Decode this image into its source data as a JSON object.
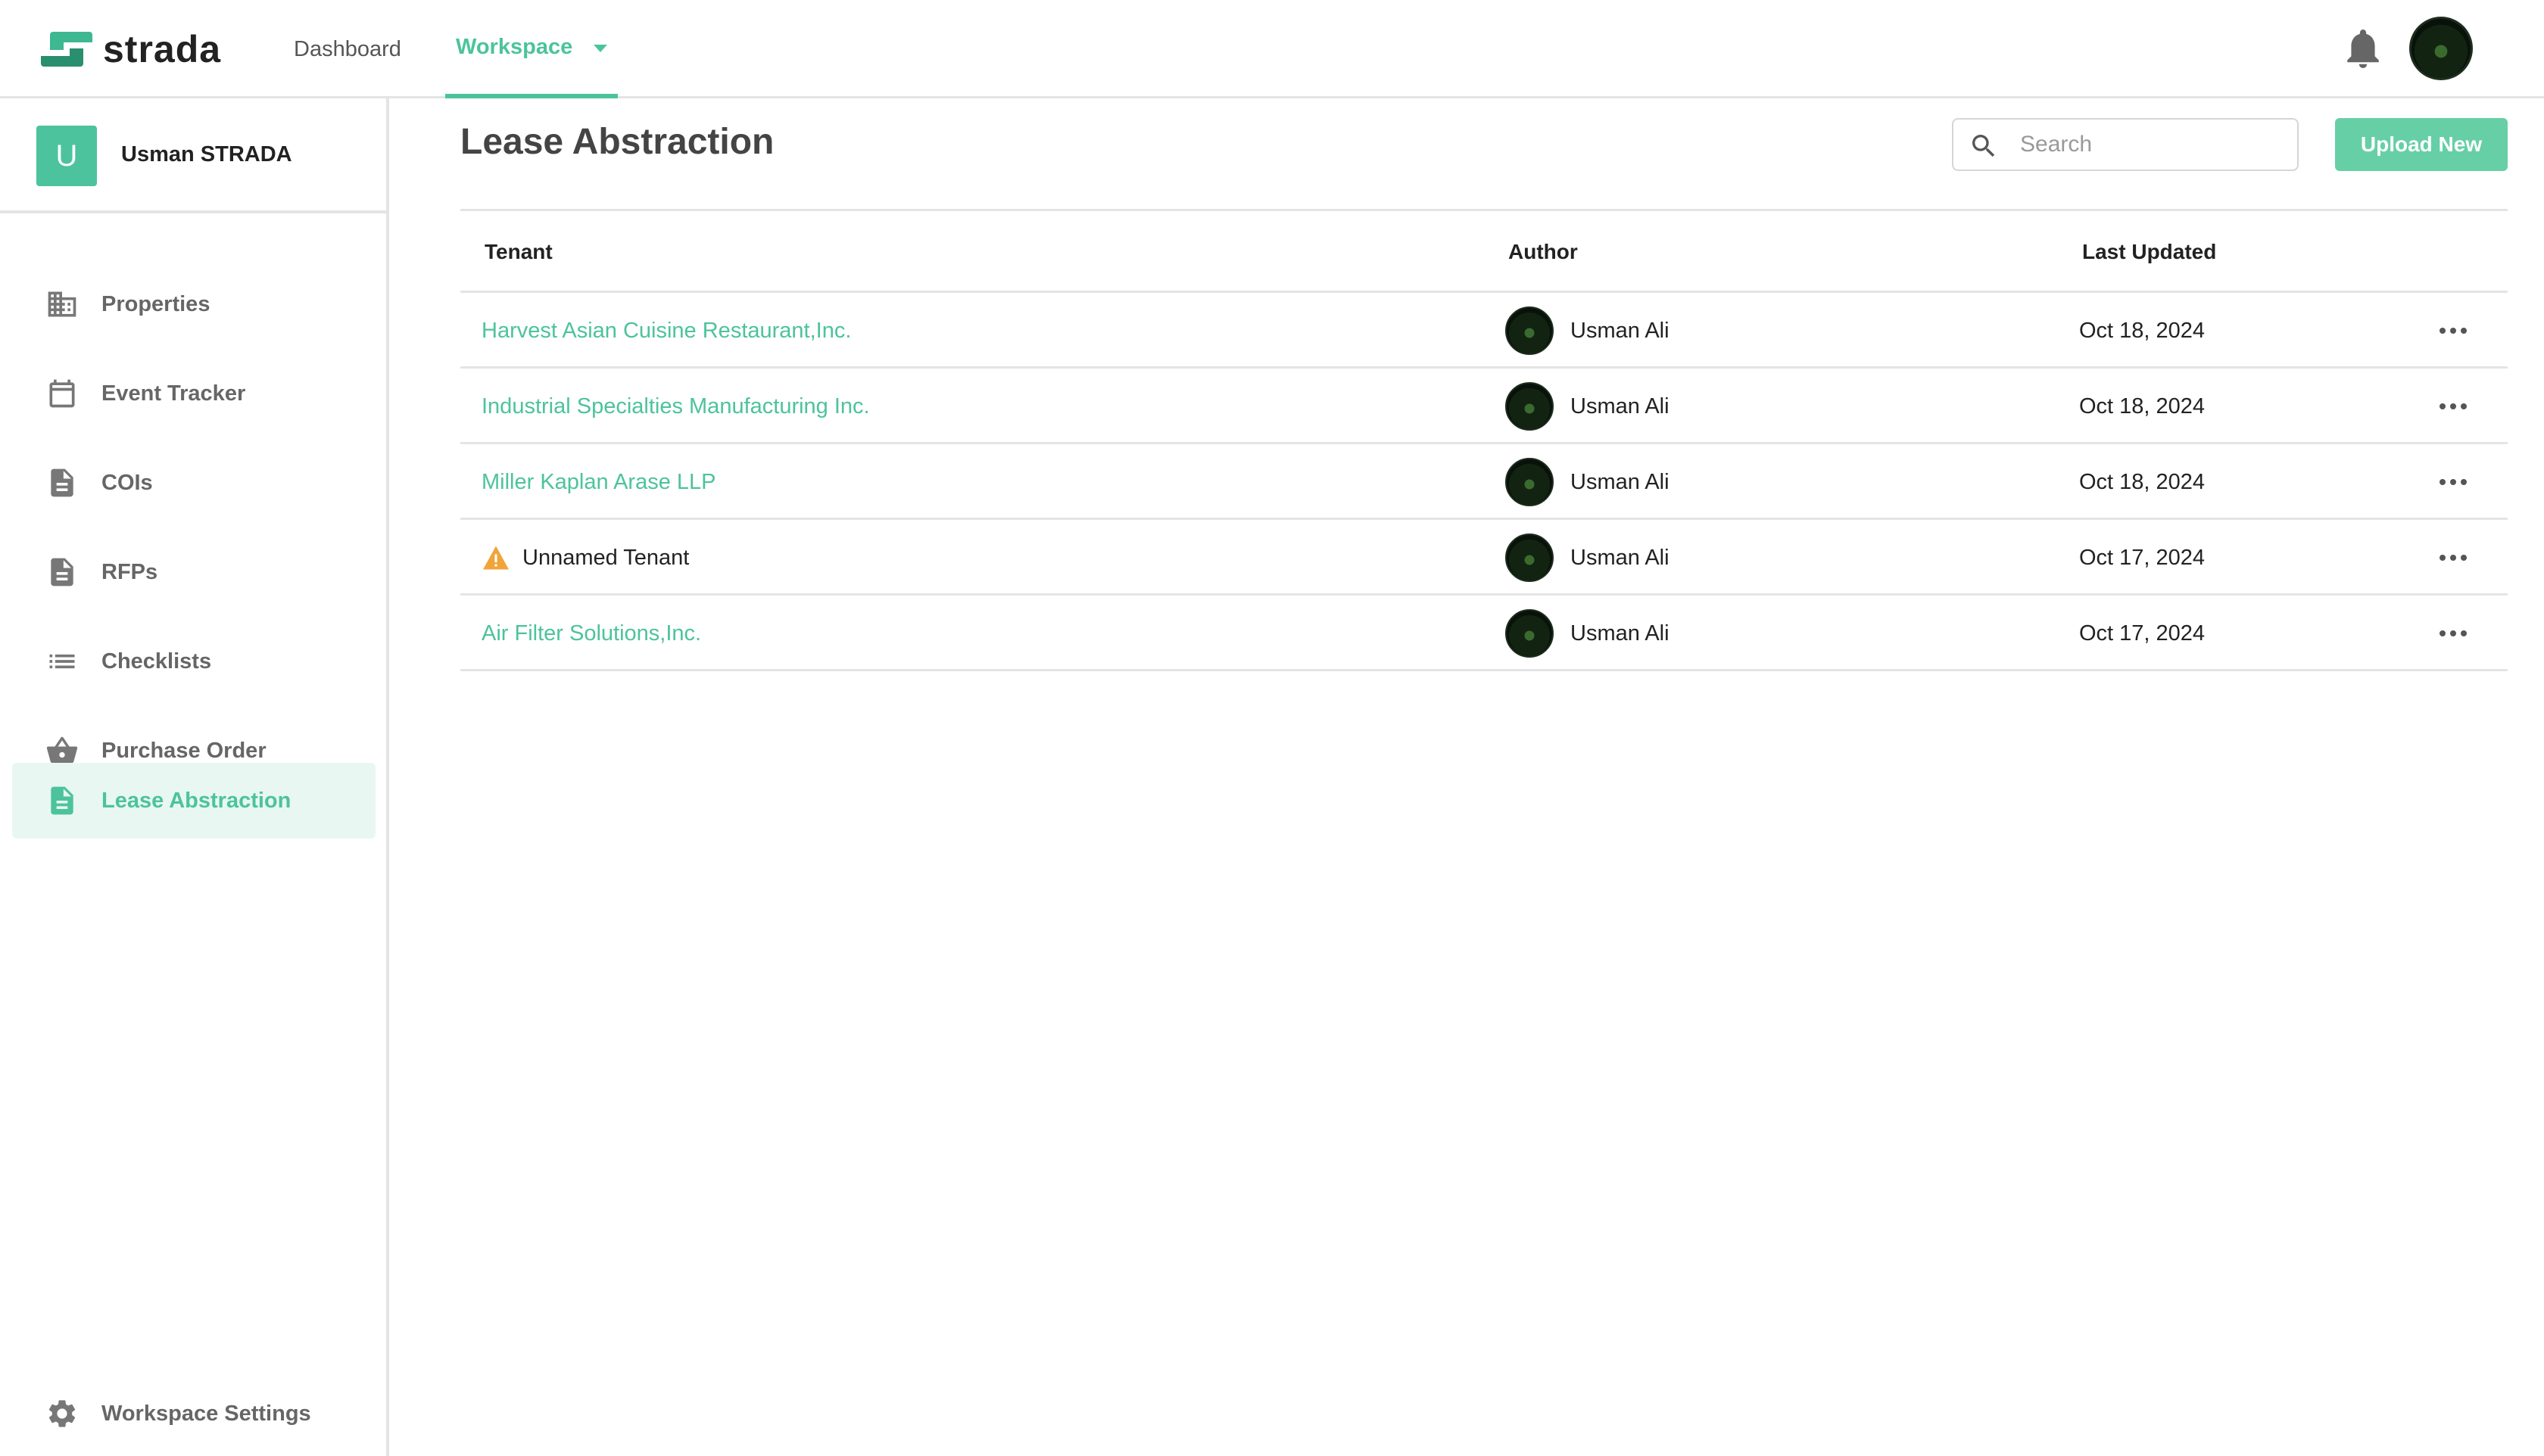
{
  "app": {
    "logo_text": "strada",
    "nav": {
      "dashboard": "Dashboard",
      "workspace": "Workspace"
    },
    "accent_color": "#4cc39c"
  },
  "sidebar": {
    "workspace_initial": "U",
    "workspace_name": "Usman STRADA",
    "items": [
      {
        "label": "Properties",
        "icon": "building-icon"
      },
      {
        "label": "Event Tracker",
        "icon": "calendar-icon"
      },
      {
        "label": "COIs",
        "icon": "document-icon"
      },
      {
        "label": "RFPs",
        "icon": "document-icon"
      },
      {
        "label": "Checklists",
        "icon": "list-icon"
      },
      {
        "label": "Purchase Order",
        "icon": "basket-icon"
      },
      {
        "label": "Lease Abstraction",
        "icon": "document-icon",
        "active": true
      }
    ],
    "settings_label": "Workspace Settings"
  },
  "main": {
    "title": "Lease Abstraction",
    "search_placeholder": "Search",
    "upload_label": "Upload New",
    "columns": {
      "tenant": "Tenant",
      "author": "Author",
      "last_updated": "Last Updated"
    },
    "rows": [
      {
        "tenant": "Harvest Asian Cuisine Restaurant,Inc.",
        "author": "Usman Ali",
        "date": "Oct 18, 2024",
        "warning": false
      },
      {
        "tenant": "Industrial Specialties Manufacturing Inc.",
        "author": "Usman Ali",
        "date": "Oct 18, 2024",
        "warning": false
      },
      {
        "tenant": "Miller Kaplan Arase LLP",
        "author": "Usman Ali",
        "date": "Oct 18, 2024",
        "warning": false
      },
      {
        "tenant": "Unnamed Tenant",
        "author": "Usman Ali",
        "date": "Oct 17, 2024",
        "warning": true
      },
      {
        "tenant": "Air Filter Solutions,Inc.",
        "author": "Usman Ali",
        "date": "Oct 17, 2024",
        "warning": false
      }
    ]
  }
}
